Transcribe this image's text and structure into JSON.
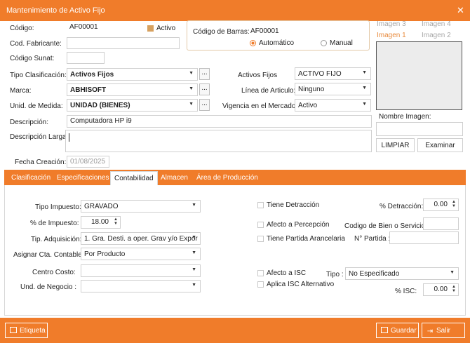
{
  "window": {
    "title": "Mantenimiento de Activo Fijo",
    "close_glyph": "✕"
  },
  "header": {
    "codigo_label": "Código:",
    "codigo_value": "AF00001",
    "activo_label": "Activo",
    "activo_checked": true,
    "cod_fabricante_label": "Cod. Fabricante:",
    "cod_fabricante_value": "",
    "codigo_sunat_label": "Código Sunat:",
    "codigo_sunat_value": "",
    "barcode_label": "Código de Barras:",
    "barcode_value": "AF00001",
    "barcode_auto_label": "Automático",
    "barcode_manual_label": "Manual",
    "barcode_mode": "Automático",
    "tipo_clasificacion_label": "Tipo Clasificación:",
    "tipo_clasificacion_value": "Activos Fijos",
    "marca_label": "Marca:",
    "marca_value": "ABHISOFT",
    "unidad_label": "Unid. de Medida:",
    "unidad_value": "UNIDAD (BIENES)",
    "dots_label": "...",
    "activos_fijos_label": "Activos Fijos",
    "activos_fijos_value": "ACTIVO FIJO",
    "linea_label": "Línea de Articulo:",
    "linea_value": "Ninguno",
    "vigencia_label": "Vigencia en el Mercado:",
    "vigencia_value": "Activo",
    "descripcion_label": "Descripción:",
    "descripcion_value": "Computadora HP i9",
    "descripcion_larga_label": "Descripción Larga:",
    "descripcion_larga_value": "",
    "fecha_label": "Fecha Creación:",
    "fecha_value": "01/08/2025"
  },
  "images": {
    "tabs": [
      "Imagen 3",
      "Imagen 4",
      "Imagen 1",
      "Imagen 2"
    ],
    "active_tab": "Imagen 1",
    "nombre_label": "Nombre Imagen:",
    "nombre_value": "",
    "limpiar_label": "LIMPIAR",
    "examinar_label": "Examinar"
  },
  "tabs": {
    "items": [
      "Clasificación",
      "Especificaciones",
      "Contabilidad",
      "Almacen",
      "Área de Producción"
    ],
    "active": "Contabilidad"
  },
  "contabilidad": {
    "tipo_impuesto_label": "Tipo Impuesto:",
    "tipo_impuesto_value": "GRAVADO",
    "pct_impuesto_label": "% de Impuesto:",
    "pct_impuesto_value": "18.00",
    "tip_adquisicion_label": "Tip. Adquisición:",
    "tip_adquisicion_value": "1. Gra. Desti. a oper. Grav y/o Expor",
    "asignar_cta_label": "Asignar Cta. Contable :",
    "asignar_cta_value": "Por Producto",
    "centro_costo_label": "Centro Costo:",
    "centro_costo_value": "",
    "und_negocio_label": "Und. de Negocio :",
    "und_negocio_value": "",
    "tiene_detraccion_label": "Tiene Detracción",
    "pct_detraccion_label": "% Detracción:",
    "pct_detraccion_value": "0.00",
    "afecto_percepcion_label": "Afecto a Percepción",
    "codigo_bien_label": "Codigo de Bien o Servicio:",
    "codigo_bien_value": "",
    "tiene_partida_label": "Tiene Partida Arancelaria",
    "n_partida_label": "N° Partida :",
    "n_partida_value": "",
    "afecto_isc_label": "Afecto a ISC",
    "tipo_label": "Tipo :",
    "tipo_value": "No Especificado",
    "aplica_isc_label": "Aplica ISC Alternativo",
    "pct_isc_label": "% ISC:",
    "pct_isc_value": "0.00"
  },
  "footer": {
    "etiqueta_label": "Etiqueta",
    "guardar_label": "Guardar",
    "salir_label": "Salir"
  },
  "colors": {
    "accent": "#f07c2a",
    "check": "#d7a15f",
    "image_tab_active": "#e88a3c"
  }
}
